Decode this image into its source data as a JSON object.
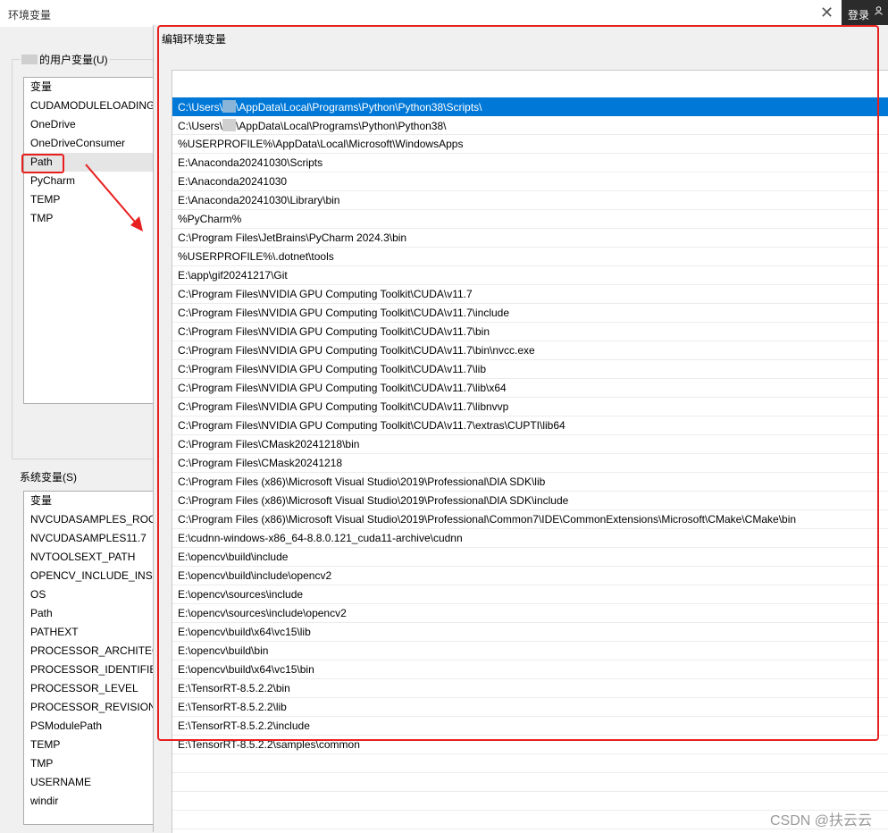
{
  "window": {
    "title": "环境变量",
    "close_glyph": "✕"
  },
  "login": {
    "label": "登录"
  },
  "user_vars": {
    "group_label": "的用户变量(U)",
    "header": "变量",
    "items": [
      "CUDAMODULELOADING",
      "OneDrive",
      "OneDriveConsumer",
      "Path",
      "PyCharm",
      "TEMP",
      "TMP"
    ]
  },
  "system_vars": {
    "group_label": "系统变量(S)",
    "header": "变量",
    "items": [
      "NVCUDASAMPLES_ROOT",
      "NVCUDASAMPLES11.7",
      "NVTOOLSEXT_PATH",
      "OPENCV_INCLUDE_INST",
      "OS",
      "Path",
      "PATHEXT",
      "PROCESSOR_ARCHITECT",
      "PROCESSOR_IDENTIFIER",
      "PROCESSOR_LEVEL",
      "PROCESSOR_REVISION",
      "PSModulePath",
      "TEMP",
      "TMP",
      "USERNAME",
      "windir"
    ]
  },
  "dialog": {
    "title": "编辑环境变量",
    "entries": [
      "\\AppData\\Local\\Programs\\Python\\Python38\\Scripts\\",
      "\\AppData\\Local\\Programs\\Python\\Python38\\",
      "%USERPROFILE%\\AppData\\Local\\Microsoft\\WindowsApps",
      "E:\\Anaconda20241030\\Scripts",
      "E:\\Anaconda20241030",
      "E:\\Anaconda20241030\\Library\\bin",
      "%PyCharm%",
      "C:\\Program Files\\JetBrains\\PyCharm 2024.3\\bin",
      "%USERPROFILE%\\.dotnet\\tools",
      "E:\\app\\gif20241217\\Git",
      "C:\\Program Files\\NVIDIA GPU Computing Toolkit\\CUDA\\v11.7",
      "C:\\Program Files\\NVIDIA GPU Computing Toolkit\\CUDA\\v11.7\\include",
      "C:\\Program Files\\NVIDIA GPU Computing Toolkit\\CUDA\\v11.7\\bin",
      "C:\\Program Files\\NVIDIA GPU Computing Toolkit\\CUDA\\v11.7\\bin\\nvcc.exe",
      "C:\\Program Files\\NVIDIA GPU Computing Toolkit\\CUDA\\v11.7\\lib",
      "C:\\Program Files\\NVIDIA GPU Computing Toolkit\\CUDA\\v11.7\\lib\\x64",
      "C:\\Program Files\\NVIDIA GPU Computing Toolkit\\CUDA\\v11.7\\libnvvp",
      "C:\\Program Files\\NVIDIA GPU Computing Toolkit\\CUDA\\v11.7\\extras\\CUPTI\\lib64",
      "C:\\Program Files\\CMask20241218\\bin",
      "C:\\Program Files\\CMask20241218",
      "C:\\Program Files (x86)\\Microsoft Visual Studio\\2019\\Professional\\DIA SDK\\lib",
      "C:\\Program Files (x86)\\Microsoft Visual Studio\\2019\\Professional\\DIA SDK\\include",
      "C:\\Program Files (x86)\\Microsoft Visual Studio\\2019\\Professional\\Common7\\IDE\\CommonExtensions\\Microsoft\\CMake\\CMake\\bin",
      "E:\\cudnn-windows-x86_64-8.8.0.121_cuda11-archive\\cudnn",
      "E:\\opencv\\build\\include",
      "E:\\opencv\\build\\include\\opencv2",
      "E:\\opencv\\sources\\include",
      "E:\\opencv\\sources\\include\\opencv2",
      "E:\\opencv\\build\\x64\\vc15\\lib",
      "E:\\opencv\\build\\bin",
      "E:\\opencv\\build\\x64\\vc15\\bin",
      "E:\\TensorRT-8.5.2.2\\bin",
      "E:\\TensorRT-8.5.2.2\\lib",
      "E:\\TensorRT-8.5.2.2\\include",
      "E:\\TensorRT-8.5.2.2\\samples\\common"
    ],
    "user_prefix": "C:\\Users\\"
  },
  "watermark": "CSDN @扶云云"
}
